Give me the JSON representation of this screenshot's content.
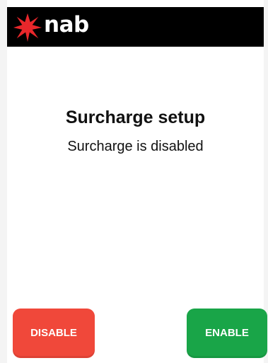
{
  "header": {
    "brand": "nab",
    "logo_icon": "nab-star-icon",
    "background_color": "#000000",
    "logo_color": "#e8272b"
  },
  "main": {
    "title": "Surcharge setup",
    "status": "Surcharge is disabled"
  },
  "actions": {
    "disable_label": "DISABLE",
    "disable_color": "#f0483a",
    "enable_label": "ENABLE",
    "enable_color": "#19a548"
  }
}
